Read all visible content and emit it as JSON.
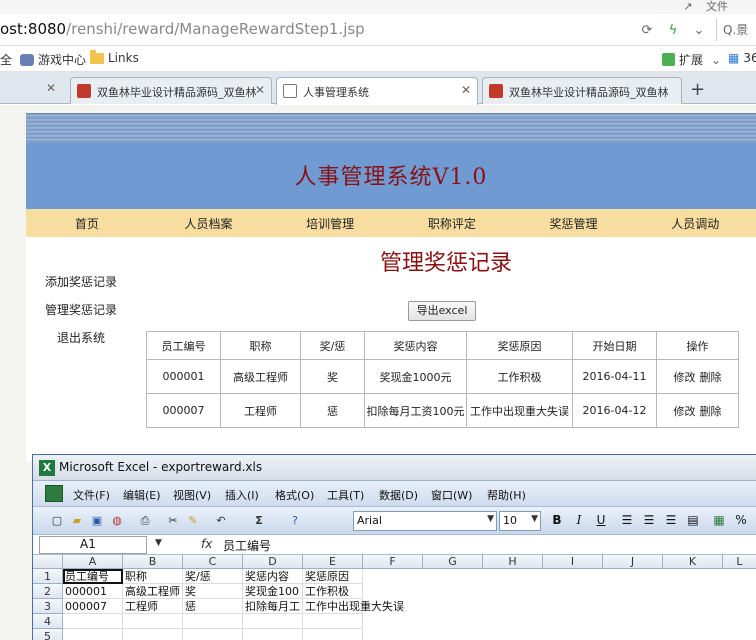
{
  "browser": {
    "top_right_label": "文件",
    "url_host": "ost:8080",
    "url_path": "/renshi/reward/ManageRewardStep1.jsp",
    "search_stub": "Q.景",
    "bookmarks": [
      "全",
      "游戏中心",
      "Links"
    ],
    "extensions_label": "扩展",
    "extensions_tail": "36",
    "tabs": [
      {
        "label": "双鱼林毕业设计精品源码_双鱼林"
      },
      {
        "label": "人事管理系统"
      },
      {
        "label": "双鱼林毕业设计精品源码_双鱼林"
      }
    ]
  },
  "app": {
    "title": "人事管理系统V1.0",
    "nav": [
      "首页",
      "人员档案",
      "培训管理",
      "职称评定",
      "奖惩管理",
      "人员调动"
    ],
    "sidebar": [
      "添加奖惩记录",
      "管理奖惩记录",
      "退出系统"
    ],
    "heading": "管理奖惩记录",
    "export_label": "导出excel",
    "table": {
      "headers": [
        "员工编号",
        "职称",
        "奖/惩",
        "奖惩内容",
        "奖惩原因",
        "开始日期",
        "操作"
      ],
      "rows": [
        {
          "id": "000001",
          "title": "高级工程师",
          "type": "奖",
          "content": "奖现金1000元",
          "reason": "工作积极",
          "date": "2016-04-11",
          "edit": "修改",
          "delete": "删除"
        },
        {
          "id": "000007",
          "title": "工程师",
          "type": "惩",
          "content": "扣除每月工资100元",
          "reason": "工作中出现重大失误",
          "date": "2016-04-12",
          "edit": "修改",
          "delete": "删除"
        }
      ]
    }
  },
  "excel": {
    "title": "Microsoft Excel - exportreward.xls",
    "menu": [
      "文件(F)",
      "编辑(E)",
      "视图(V)",
      "插入(I)",
      "格式(O)",
      "工具(T)",
      "数据(D)",
      "窗口(W)",
      "帮助(H)"
    ],
    "font_name": "Arial",
    "font_size": "10",
    "name_box": "A1",
    "fx_symbol": "fx",
    "formula_value": "员工编号",
    "columns": [
      "A",
      "B",
      "C",
      "D",
      "E",
      "F",
      "G",
      "H",
      "I",
      "J",
      "K",
      "L"
    ],
    "rows": [
      "1",
      "2",
      "3",
      "4",
      "5"
    ],
    "cells": [
      [
        "员工编号",
        "职称",
        "奖/惩",
        "奖惩内容",
        "奖惩原因"
      ],
      [
        "000001",
        "高级工程师",
        "奖",
        "奖现金100",
        "工作积极"
      ],
      [
        "000007",
        "工程师",
        "惩",
        "扣除每月工",
        "工作中出现重大失误"
      ]
    ]
  }
}
